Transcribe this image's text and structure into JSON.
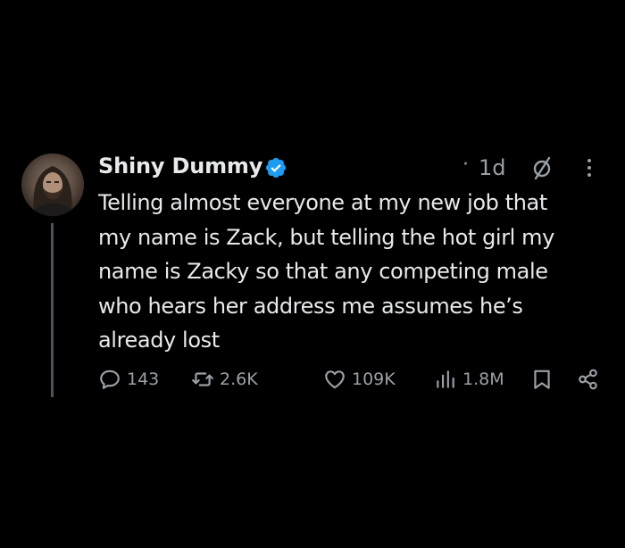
{
  "post": {
    "author_name": "Shiny Dummy",
    "separator": "·",
    "time_ago": "1d",
    "body_lines": [
      "Telling almost everyone at my new job that",
      "my name is Zack, but telling the hot girl my",
      "name is Zacky so that any competing male",
      "who hears her address me assumes he’s",
      "already lost"
    ]
  },
  "metrics": {
    "replies": "143",
    "reposts": "2.6K",
    "likes": "109K",
    "views": "1.8M"
  },
  "icons": {
    "verified": "verified-badge-icon",
    "grok": "grok-icon",
    "more": "more-icon",
    "reply": "reply-icon",
    "repost": "repost-icon",
    "like": "heart-icon",
    "views": "views-icon",
    "bookmark": "bookmark-icon",
    "share": "share-icon"
  },
  "colors": {
    "background": "#000000",
    "text_primary": "#e7e9ea",
    "text_secondary": "#9aa0a6",
    "verified_blue": "#1d9bf0",
    "thread_line": "#4e5257"
  }
}
